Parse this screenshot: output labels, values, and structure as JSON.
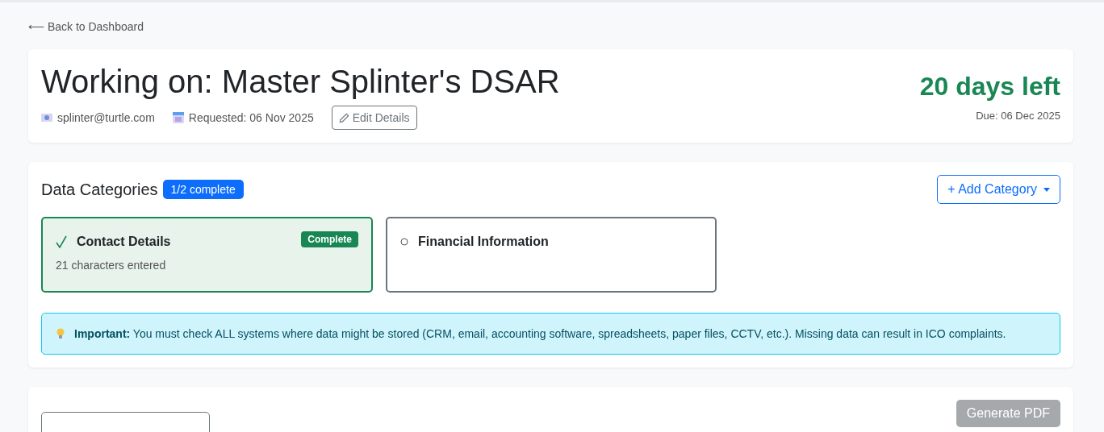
{
  "back_link": "⟵ Back to Dashboard",
  "header": {
    "title": "Working on: Master Splinter's DSAR",
    "email": "splinter@turtle.com",
    "requested": "Requested: 06 Nov 2025",
    "edit_button": "Edit Details",
    "days_left": "20 days left",
    "due": "Due: 06 Dec 2025"
  },
  "categories": {
    "title": "Data Categories",
    "progress_badge": "1/2 complete",
    "add_button": "+ Add Category",
    "items": [
      {
        "name": "Contact Details",
        "complete": true,
        "badge": "Complete",
        "detail": "21 characters entered"
      },
      {
        "name": "Financial Information",
        "complete": false
      }
    ],
    "notice": "**Important:** You must check ALL systems where data might be stored (CRM, email, accounting software, spreadsheets, paper files, CCTV, etc.). Missing data can result in ICO complaints."
  },
  "footer": {
    "generate_button": {
      "label": "Generate PDF",
      "disabled": true
    }
  }
}
